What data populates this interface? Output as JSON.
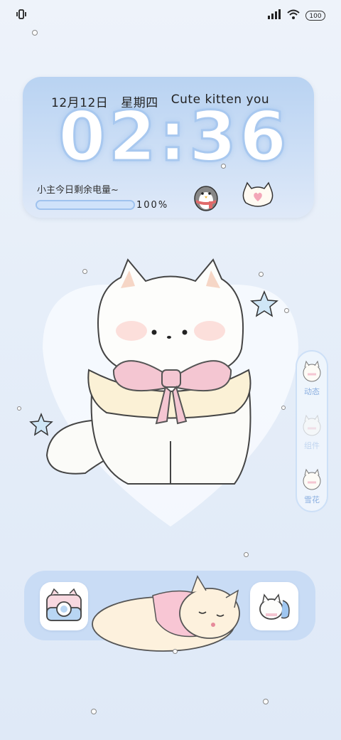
{
  "status_bar": {
    "battery_level": "100",
    "icons": [
      "vibrate-icon",
      "signal-icon",
      "wifi-icon",
      "battery-icon"
    ]
  },
  "clock_widget": {
    "date": "12月12日",
    "weekday": "星期四",
    "tagline": "Cute kitten you",
    "time": "02:36",
    "battery_caption": "小主今日剩余电量~",
    "battery_percent_text": "100%",
    "battery_percent_value": 1.0
  },
  "side_dock": {
    "items": [
      {
        "label": "动态"
      },
      {
        "label": "组件"
      },
      {
        "label": "雪花"
      }
    ]
  },
  "bottom_dock": {
    "apps": [
      "camera-app-icon",
      "cat-phone-app-icon"
    ]
  },
  "colors": {
    "accent_blue": "#a8c8ef",
    "widget_bg": "#c4daf4",
    "label_blue": "#8aaee0",
    "pink_bow": "#f4c6d2"
  }
}
